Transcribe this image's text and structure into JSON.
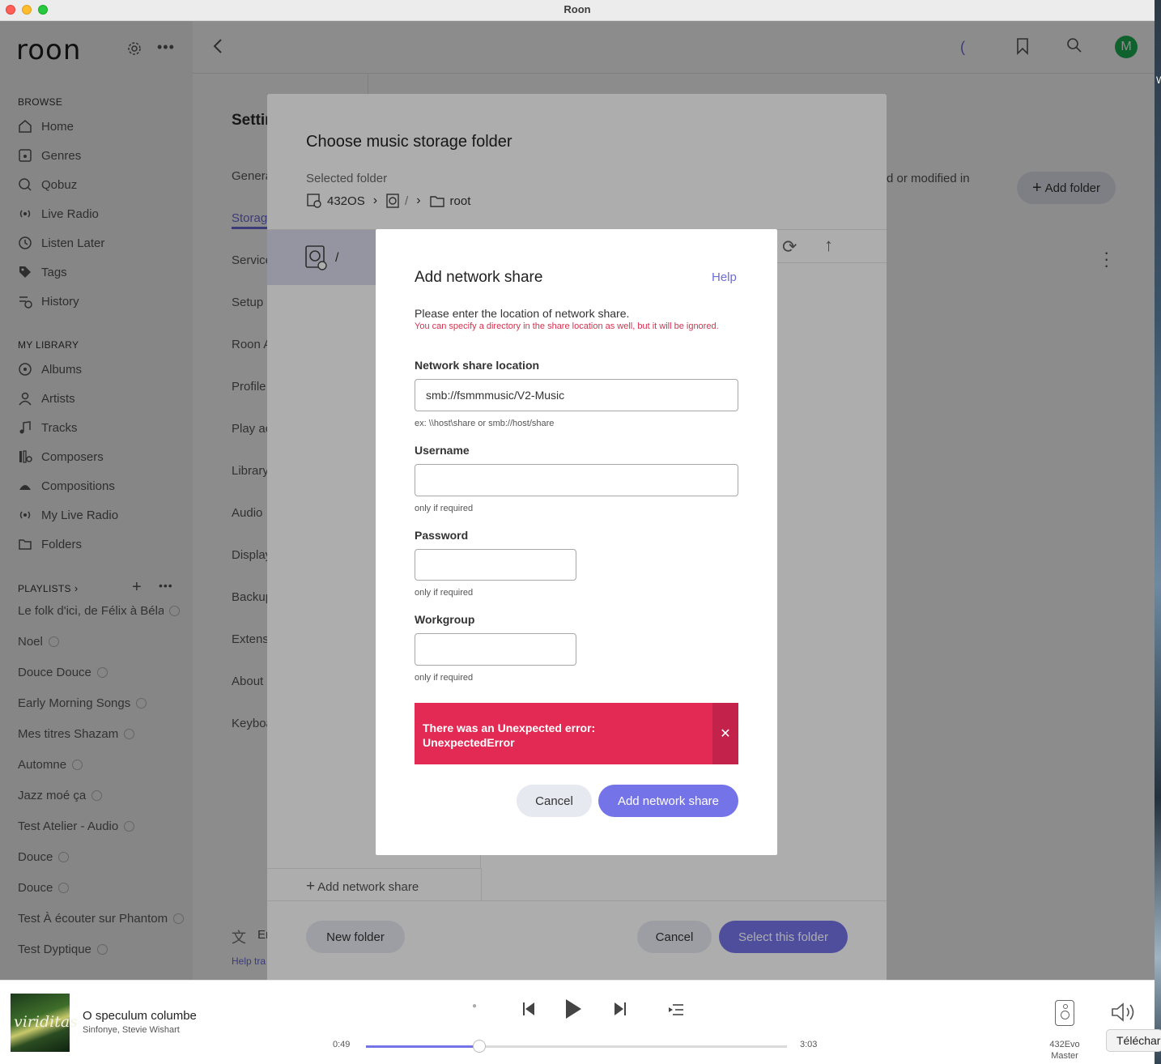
{
  "window": {
    "title": "Roon"
  },
  "sidebar": {
    "logo": "roon",
    "browse_title": "BROWSE",
    "browse": [
      {
        "label": "Home",
        "icon": "home-icon"
      },
      {
        "label": "Genres",
        "icon": "genres-icon"
      },
      {
        "label": "Qobuz",
        "icon": "qobuz-icon"
      },
      {
        "label": "Live Radio",
        "icon": "radio-icon"
      },
      {
        "label": "Listen Later",
        "icon": "clock-icon"
      },
      {
        "label": "Tags",
        "icon": "tag-icon"
      },
      {
        "label": "History",
        "icon": "history-icon"
      }
    ],
    "library_title": "MY LIBRARY",
    "library": [
      {
        "label": "Albums",
        "icon": "album-icon"
      },
      {
        "label": "Artists",
        "icon": "artist-icon"
      },
      {
        "label": "Tracks",
        "icon": "note-icon"
      },
      {
        "label": "Composers",
        "icon": "composer-icon"
      },
      {
        "label": "Compositions",
        "icon": "composition-icon"
      },
      {
        "label": "My Live Radio",
        "icon": "radio-icon"
      },
      {
        "label": "Folders",
        "icon": "folder-icon"
      }
    ],
    "playlists_title": "PLAYLISTS",
    "playlists": [
      "Le folk d'ici, de Félix à Béla",
      "Noel",
      "Douce Douce",
      "Early Morning Songs",
      "Mes titres Shazam",
      "Automne",
      "Jazz moé ça",
      "Test Atelier - Audio",
      "Douce",
      "Douce",
      "Test À écouter sur Phantom",
      "Test Dyptique"
    ]
  },
  "topbar": {
    "avatar_letter": "M",
    "loading_glyph": "("
  },
  "settings": {
    "title": "Settin",
    "nav": [
      "Genera",
      "Storag",
      "Service",
      "Setup",
      "Roon A",
      "Profile",
      "Play ac",
      "Library",
      "Audio",
      "Display",
      "Backup",
      "Extens",
      "About",
      "Keyboa"
    ],
    "active_index": 1,
    "desc_fragment": "d or modified in",
    "add_folder": "Add folder",
    "language_fragment": "En",
    "help_translate": "Help tra"
  },
  "storage_dialog": {
    "title": "Choose music storage folder",
    "selected_label": "Selected folder",
    "breadcrumb": [
      "432OS",
      "/",
      "root"
    ],
    "drive_name": "/",
    "add_network_share": "Add network share",
    "new_folder": "New folder",
    "cancel": "Cancel",
    "select": "Select this folder"
  },
  "share_dialog": {
    "title": "Add network share",
    "help": "Help",
    "intro": "Please enter the location of network share.",
    "warning": "You can specify a directory in the share location as well, but it will be ignored.",
    "location_label": "Network share location",
    "location_value": "smb://fsmmmusic/V2-Music",
    "location_hint": "ex: \\\\host\\share or smb://host/share",
    "username_label": "Username",
    "username_hint": "only if required",
    "password_label": "Password",
    "password_hint": "only if required",
    "workgroup_label": "Workgroup",
    "workgroup_hint": "only if required",
    "error": "There was an Unexpected error: UnexpectedError",
    "cancel": "Cancel",
    "submit": "Add network share"
  },
  "player": {
    "cover_text": "viriditas",
    "track": "O speculum columbe",
    "artist": "Sinfonye, Stevie Wishart",
    "elapsed": "0:49",
    "duration": "3:03",
    "progress": 0.27,
    "zone_name": "432Evo",
    "zone_role": "Master"
  },
  "desktop": {
    "download_fragment": "Télécharg",
    "corner_fragment": "W"
  },
  "colors": {
    "accent": "#7474e8",
    "error": "#e22a54",
    "avatar": "#1db354"
  }
}
